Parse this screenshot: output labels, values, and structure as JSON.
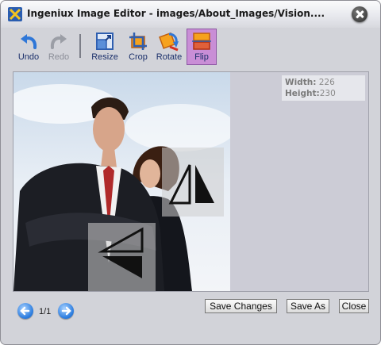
{
  "window": {
    "title": "Ingeniux Image Editor - images/About_Images/Vision...."
  },
  "toolbar": {
    "undo": "Undo",
    "redo": "Redo",
    "resize": "Resize",
    "crop": "Crop",
    "rotate": "Rotate",
    "flip": "Flip"
  },
  "image": {
    "width_label": "Width:",
    "width_value": "226",
    "height_label": "Height:",
    "height_value": "230"
  },
  "pagination": {
    "current": "1/1"
  },
  "buttons": {
    "save_changes": "Save Changes",
    "save_as": "Save As",
    "close": "Close"
  },
  "icons": {
    "app": "ingeniux-logo-icon",
    "close": "close-icon",
    "undo": "undo-arrow-icon",
    "redo": "redo-arrow-icon",
    "resize": "resize-icon",
    "crop": "crop-icon",
    "rotate": "rotate-icon",
    "flip": "flip-icon",
    "flip_horizontal": "flip-horizontal-icon",
    "flip_vertical": "flip-vertical-icon",
    "prev": "previous-arrow-icon",
    "next": "next-arrow-icon"
  },
  "colors": {
    "accent_flip": "#c98ed6",
    "nav_blue": "#2f7fe0"
  }
}
